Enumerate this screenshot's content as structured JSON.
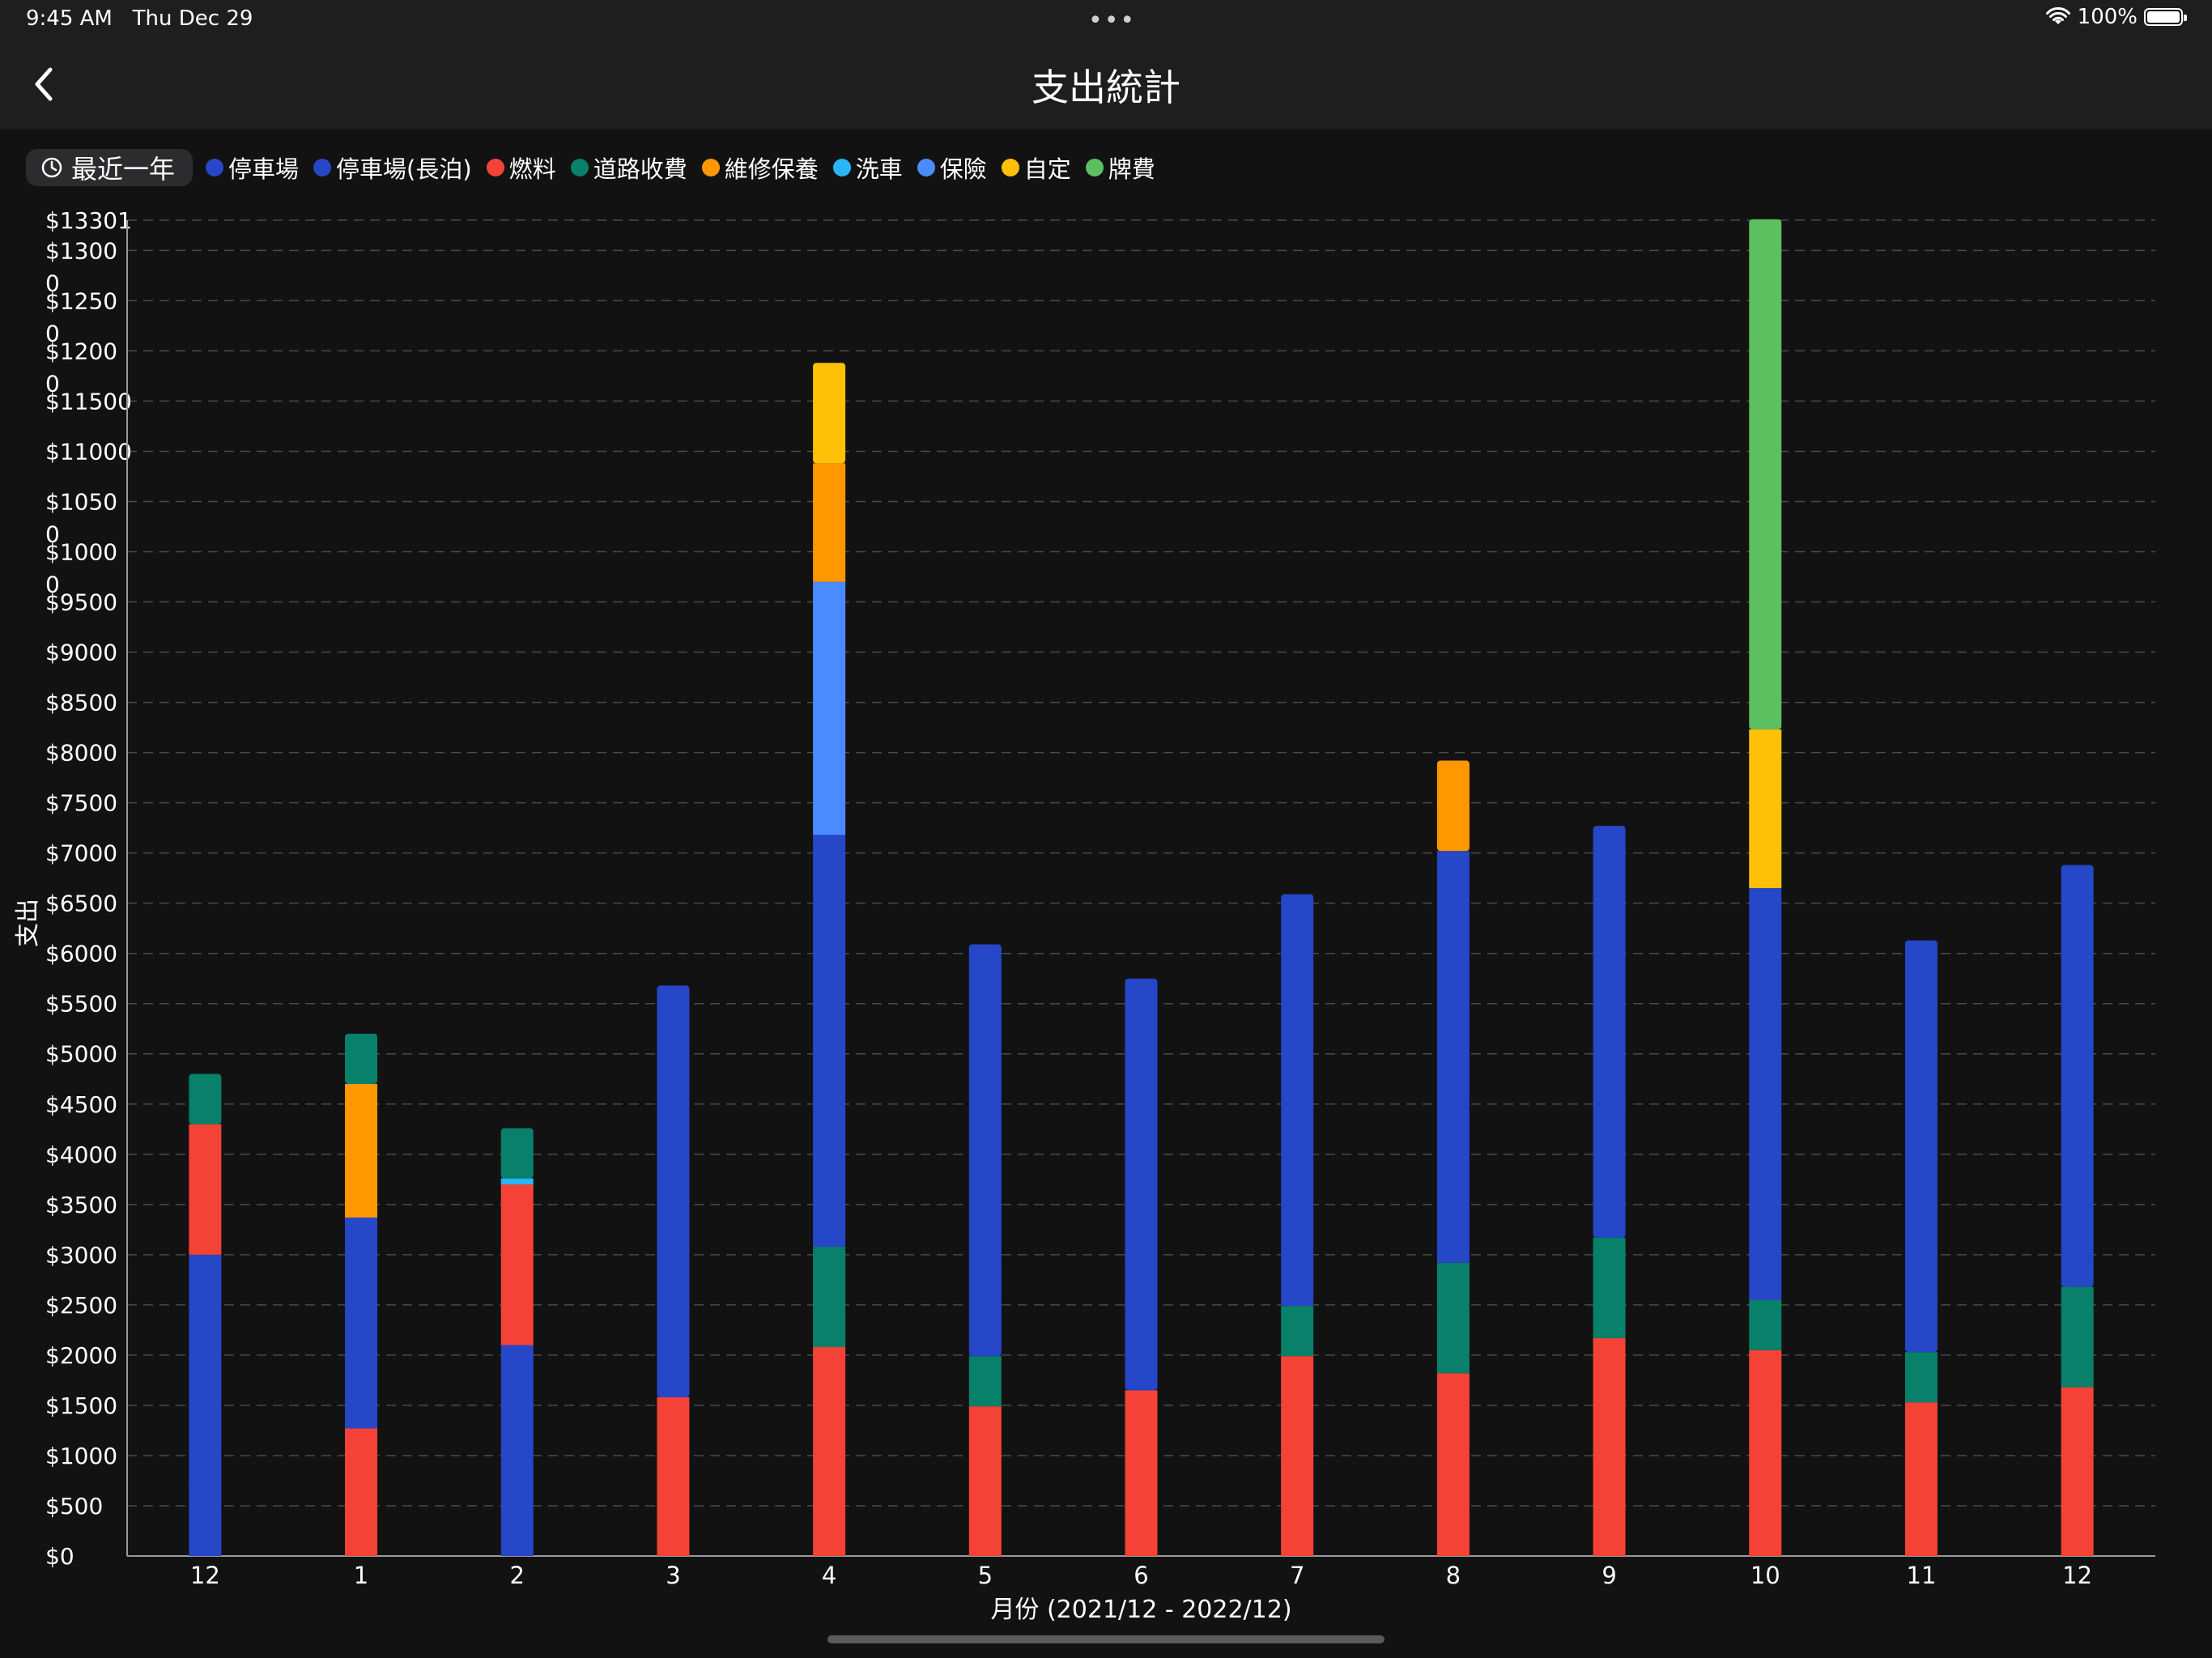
{
  "status": {
    "time": "9:45 AM",
    "date": "Thu Dec 29",
    "dots": "•••",
    "battery": "100%"
  },
  "nav": {
    "title": "支出統計"
  },
  "filter": {
    "label": "最近一年"
  },
  "legend": [
    {
      "name": "停車場",
      "color": "#2547c8"
    },
    {
      "name": "停車場(長泊)",
      "color": "#2547c8"
    },
    {
      "name": "燃料",
      "color": "#f44336"
    },
    {
      "name": "道路收費",
      "color": "#08806a"
    },
    {
      "name": "維修保養",
      "color": "#ff9800"
    },
    {
      "name": "洗車",
      "color": "#29b6f6"
    },
    {
      "name": "保險",
      "color": "#4a8cff"
    },
    {
      "name": "自定",
      "color": "#ffc107"
    },
    {
      "name": "牌費",
      "color": "#5cbf60"
    }
  ],
  "chart_data": {
    "type": "bar",
    "stacked": true,
    "xlabel": "月份 (2021/12 - 2022/12)",
    "ylabel": "支出",
    "ylim": [
      0,
      13301
    ],
    "y_ticks": [
      0,
      500,
      1000,
      1500,
      2000,
      2500,
      3000,
      3500,
      4000,
      4500,
      5000,
      5500,
      6000,
      6500,
      7000,
      7500,
      8000,
      8500,
      9000,
      9500,
      10000,
      10500,
      11000,
      11500,
      12000,
      12500,
      13000,
      13301
    ],
    "y_tick_labels": [
      "$0",
      "$500",
      "$1000",
      "$1500",
      "$2000",
      "$2500",
      "$3000",
      "$3500",
      "$4000",
      "$4500",
      "$5000",
      "$5500",
      "$6000",
      "$6500",
      "$7000",
      "$7500",
      "$8000",
      "$8500",
      "$9000",
      "$9500",
      "$1000\n0",
      "$1050\n0",
      "$11000",
      "$11500",
      "$1200\n0",
      "$1250\n0",
      "$1300\n0",
      "$13301"
    ],
    "grid": true,
    "categories": [
      "12",
      "1",
      "2",
      "3",
      "4",
      "5",
      "6",
      "7",
      "8",
      "9",
      "10",
      "11",
      "12"
    ],
    "series": [
      {
        "name": "停車場",
        "color": "#2547c8",
        "values": [
          700,
          0,
          0,
          0,
          0,
          0,
          0,
          0,
          0,
          0,
          0,
          0,
          0
        ]
      },
      {
        "name": "停車場(長泊)",
        "color": "#2547c8",
        "values": [
          2300,
          2100,
          2100,
          4100,
          4100,
          4100,
          4100,
          4100,
          4100,
          4100,
          4100,
          4100,
          4200
        ]
      },
      {
        "name": "燃料",
        "color": "#f44336",
        "values": [
          1300,
          1270,
          1600,
          1580,
          2080,
          1490,
          1650,
          1990,
          1820,
          2170,
          2050,
          1530,
          1680
        ]
      },
      {
        "name": "道路收費",
        "color": "#08806a",
        "values": [
          500,
          500,
          500,
          0,
          1000,
          500,
          0,
          500,
          1100,
          1000,
          500,
          500,
          1000
        ]
      },
      {
        "name": "維修保養",
        "color": "#ff9800",
        "values": [
          0,
          1330,
          0,
          0,
          1180,
          0,
          0,
          0,
          900,
          0,
          0,
          0,
          0
        ]
      },
      {
        "name": "洗車",
        "color": "#29b6f6",
        "values": [
          0,
          0,
          60,
          0,
          0,
          0,
          0,
          0,
          0,
          0,
          0,
          0,
          0
        ]
      },
      {
        "name": "保險",
        "color": "#4a8cff",
        "values": [
          0,
          0,
          0,
          0,
          2520,
          0,
          0,
          0,
          0,
          0,
          0,
          0,
          0
        ]
      },
      {
        "name": "自定",
        "color": "#ffc107",
        "values": [
          0,
          0,
          0,
          0,
          1000,
          0,
          0,
          0,
          0,
          0,
          1580,
          0,
          0
        ]
      },
      {
        "name": "牌費",
        "color": "#5cbf60",
        "values": [
          0,
          0,
          0,
          0,
          0,
          0,
          0,
          0,
          0,
          0,
          5080,
          0,
          0
        ]
      }
    ],
    "stack_order": [
      "燃料",
      "道路收費",
      "停車場",
      "停車場(長泊)",
      "洗車",
      "保險",
      "維修保養",
      "自定",
      "牌費"
    ],
    "stack_order_overrides": {
      "0": [
        "停車場",
        "停車場(長泊)",
        "燃料",
        "道路收費"
      ],
      "1": [
        "燃料",
        "停車場(長泊)",
        "維修保養",
        "道路收費"
      ],
      "2": [
        "停車場(長泊)",
        "燃料",
        "洗車",
        "道路收費"
      ]
    }
  }
}
